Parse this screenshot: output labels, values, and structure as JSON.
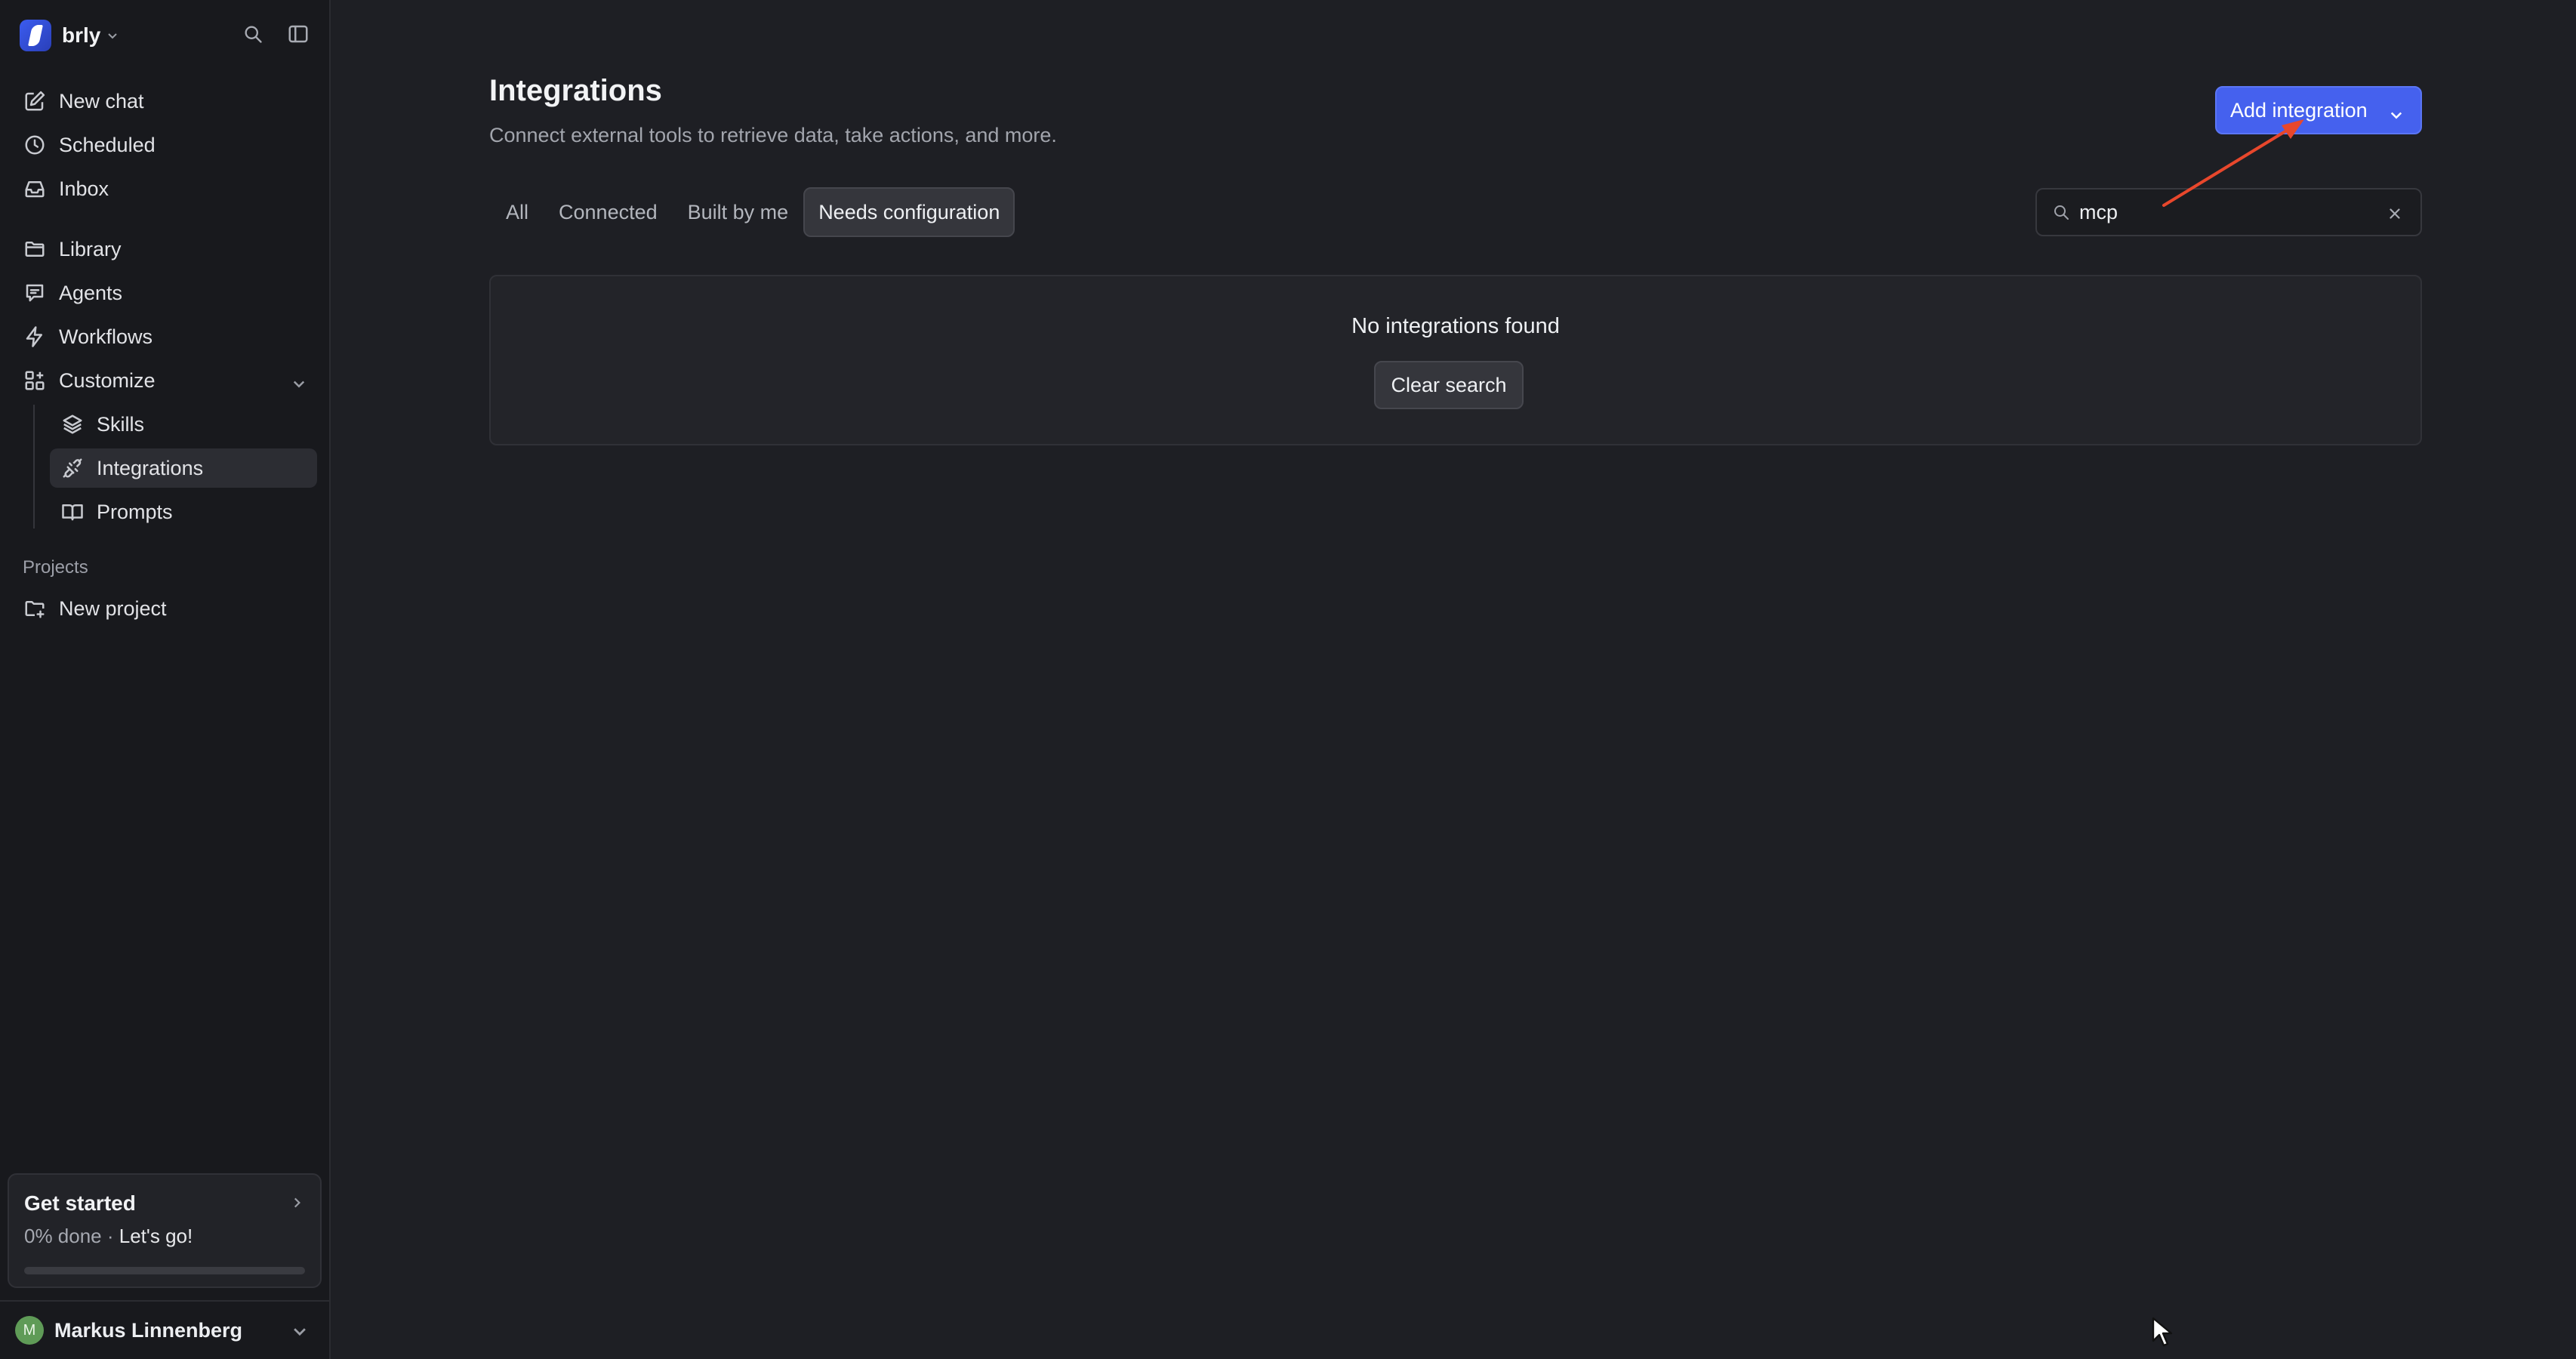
{
  "workspace": {
    "name": "brly"
  },
  "sidebar": {
    "primary": [
      {
        "label": "New chat",
        "icon": "pencil-square-icon"
      },
      {
        "label": "Scheduled",
        "icon": "clock-icon"
      },
      {
        "label": "Inbox",
        "icon": "inbox-icon"
      }
    ],
    "secondary": [
      {
        "label": "Library",
        "icon": "folder-icon"
      },
      {
        "label": "Agents",
        "icon": "agent-chat-icon"
      },
      {
        "label": "Workflows",
        "icon": "lightning-icon"
      },
      {
        "label": "Customize",
        "icon": "grid-plus-icon"
      }
    ],
    "customize_children": [
      {
        "label": "Skills",
        "icon": "layers-icon"
      },
      {
        "label": "Integrations",
        "icon": "plug-icon",
        "active": true
      },
      {
        "label": "Prompts",
        "icon": "book-icon"
      }
    ],
    "projects_label": "Projects",
    "new_project": "New project",
    "get_started": {
      "title": "Get started",
      "progress_text": "0% done",
      "separator": " · ",
      "cta": "Let's go!",
      "progress_fraction": 0
    },
    "user": {
      "name": "Markus Linnenberg",
      "initial": "M"
    }
  },
  "main": {
    "title": "Integrations",
    "subtitle": "Connect external tools to retrieve data, take actions, and more.",
    "add_button": "Add integration",
    "tabs": [
      {
        "label": "All"
      },
      {
        "label": "Connected"
      },
      {
        "label": "Built by me"
      },
      {
        "label": "Needs configuration",
        "active": true
      }
    ],
    "search": {
      "value": "mcp",
      "placeholder": "Search"
    },
    "empty_state": {
      "title": "No integrations found",
      "clear_button": "Clear search"
    }
  },
  "colors": {
    "accent": "#4561ee",
    "annotation_arrow": "#e8472c",
    "avatar": "#5f9b57"
  }
}
